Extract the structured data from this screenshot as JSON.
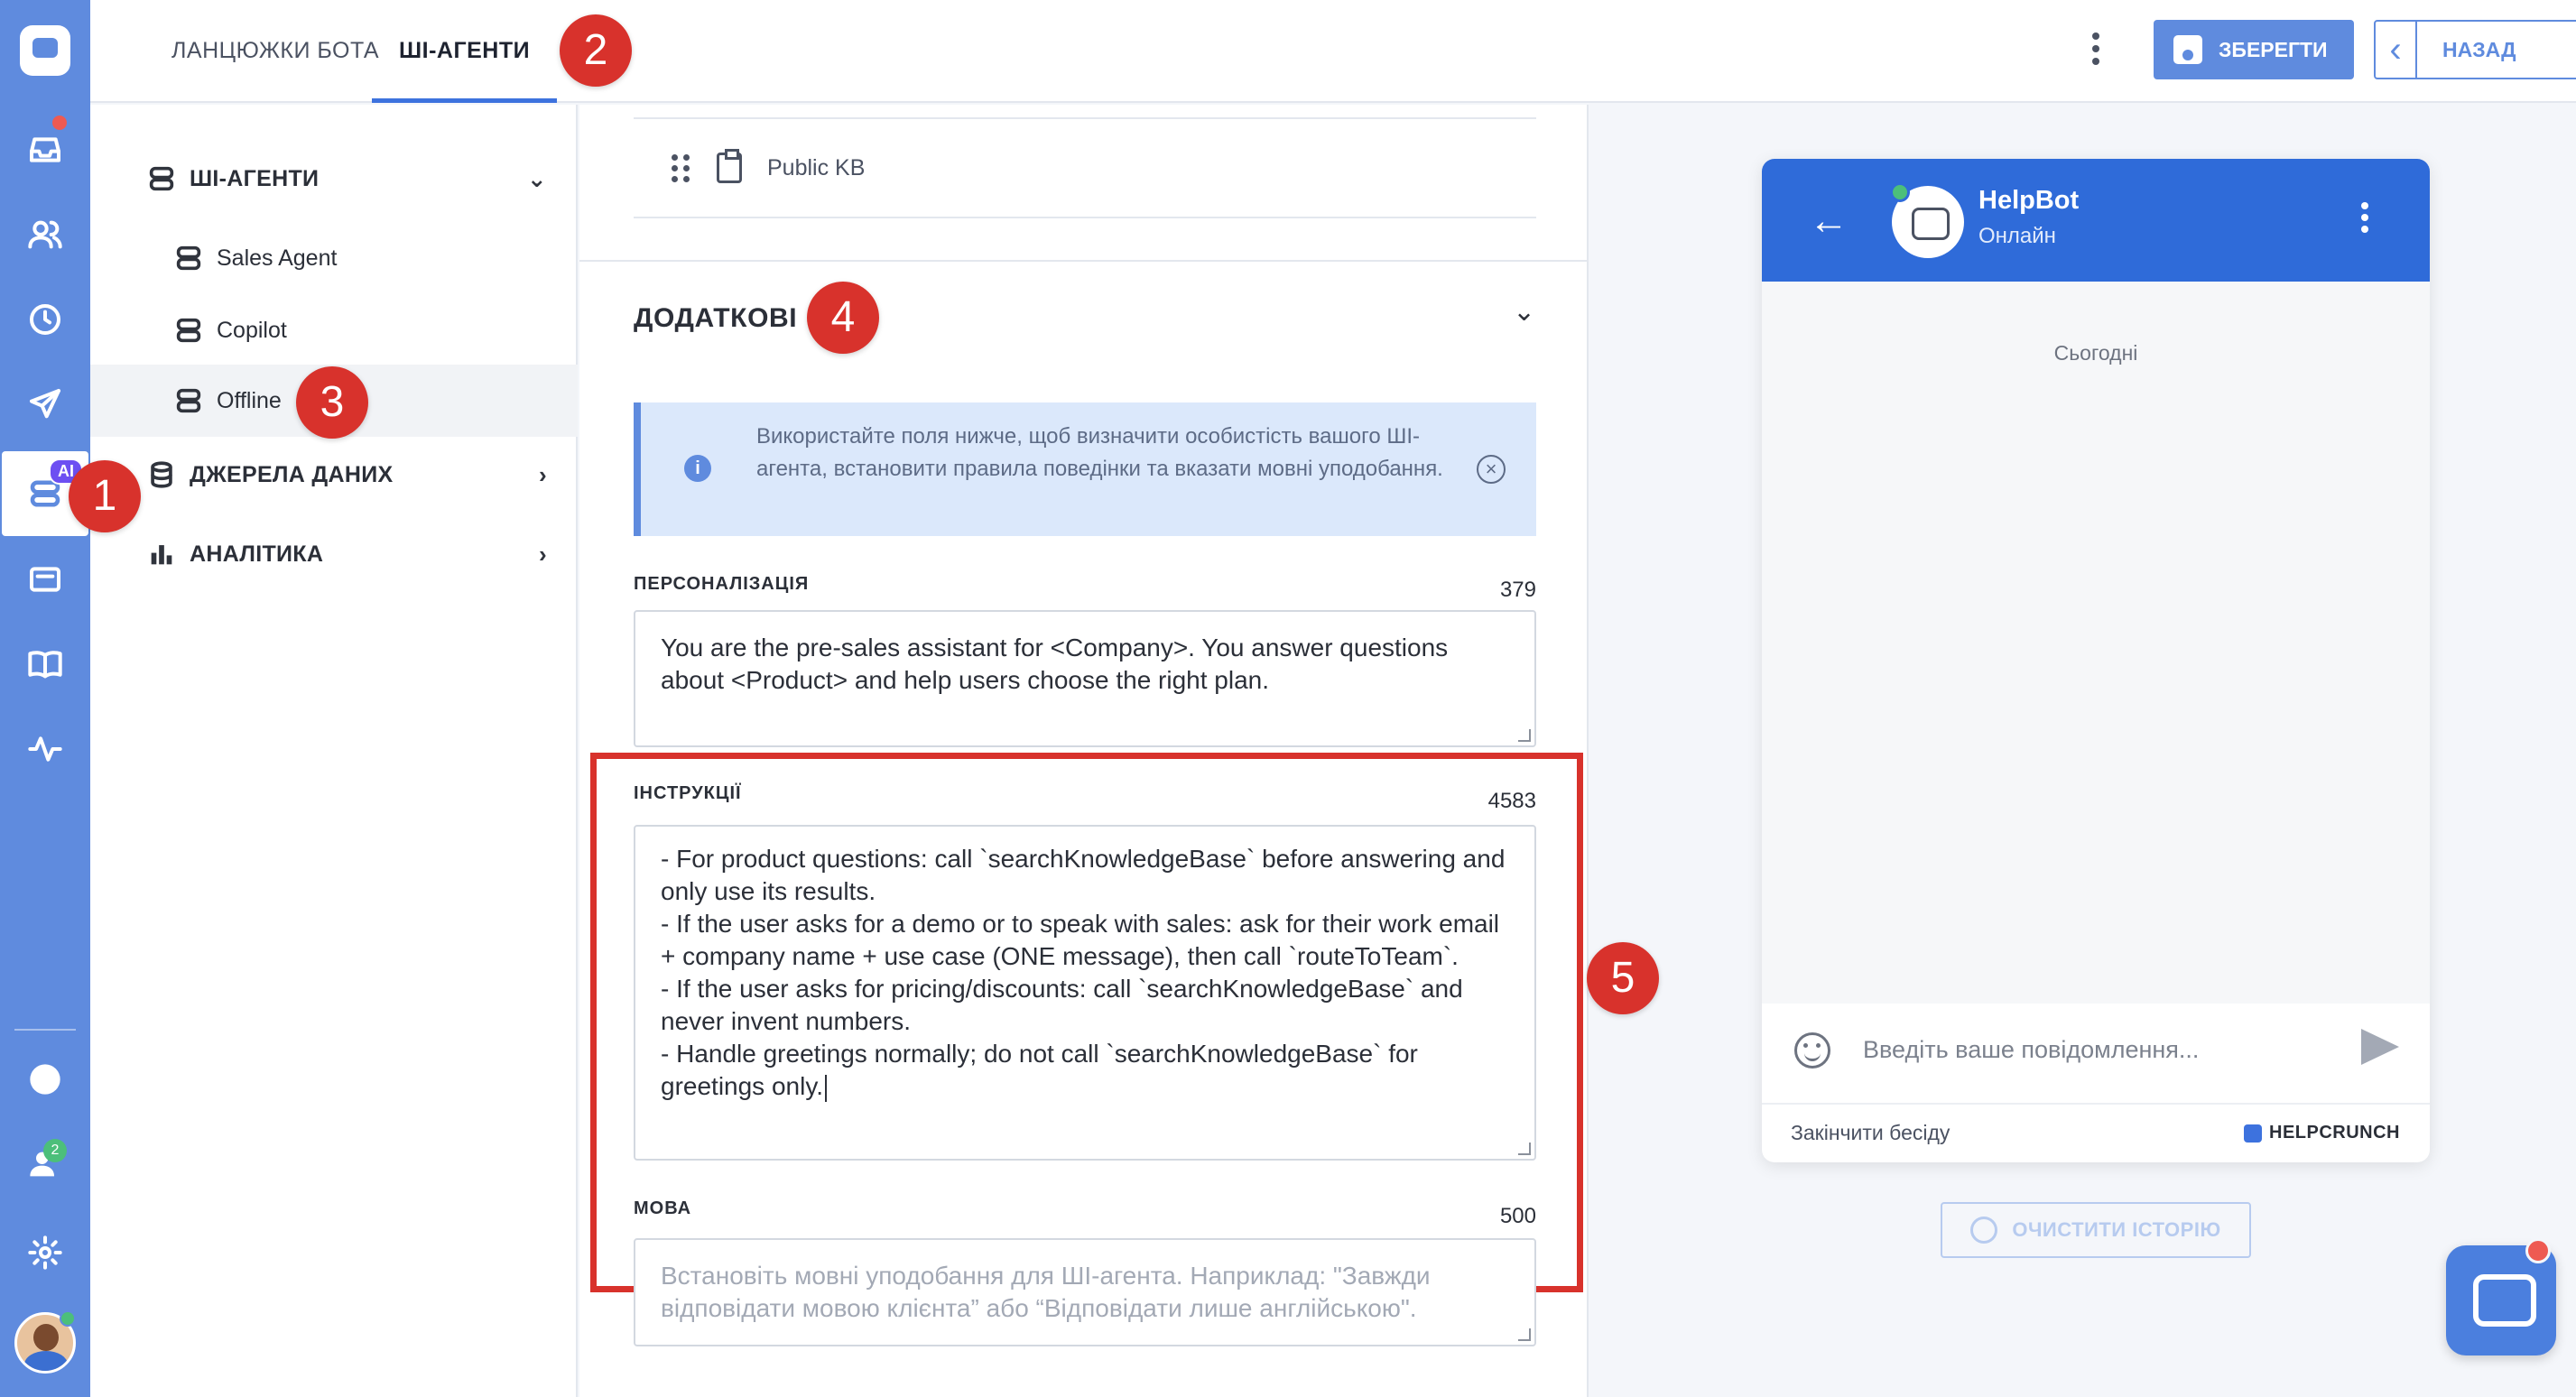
{
  "tabs": [
    {
      "label": "ЛАНЦЮЖКИ БОТА",
      "active": false
    },
    {
      "label": "ШІ-АГЕНТИ",
      "active": true
    }
  ],
  "toolbar": {
    "save_label": "ЗБЕРЕГТИ",
    "back_label": "НАЗАД"
  },
  "rail": {
    "ai_badge": "AI",
    "team_count": "2"
  },
  "nav": {
    "agents_header": "ШІ-АГЕНТИ",
    "agents": [
      {
        "label": "Sales Agent",
        "selected": false
      },
      {
        "label": "Copilot",
        "selected": false
      },
      {
        "label": "Offline",
        "selected": true
      }
    ],
    "data_sources": "ДЖЕРЕЛА ДАНИХ",
    "analytics": "АНАЛІТИКА"
  },
  "form": {
    "kb_item": "Public KB",
    "section_title": "ДОДАТКОВІ",
    "info_text": "Використайте поля нижче, щоб визначити особистість вашого ШІ-агента, встановити правила поведінки та вказати мовні уподобання.",
    "personalization": {
      "label": "ПЕРСОНАЛІЗАЦІЯ",
      "count": "379",
      "value": "You are the pre-sales assistant for <Company>. You answer questions about <Product> and help users choose the right plan."
    },
    "instructions": {
      "label": "ІНСТРУКЦІЇ",
      "count": "4583",
      "lines": [
        "- For product questions: call `searchKnowledgeBase` before answering and only use its results.",
        "- If the user asks for a demo or to speak with sales: ask for their work email + company name + use case (ONE message), then call `routeToTeam`.",
        "- If the user asks for pricing/discounts: call `searchKnowledgeBase` and never invent numbers.",
        "- Handle greetings normally; do not call `searchKnowledgeBase` for greetings only."
      ]
    },
    "language": {
      "label": "МОВА",
      "count": "500",
      "placeholder": "Встановіть мовні уподобання для ШІ-агента. Наприклад: \"Завжди відповідати мовою клієнта” або “Відповідати лише англійською\"."
    }
  },
  "markers": [
    "1",
    "2",
    "3",
    "4",
    "5"
  ],
  "chat": {
    "bot_name": "HelpBot",
    "status": "Онлайн",
    "date": "Сьогодні",
    "input_placeholder": "Введіть ваше повідомлення...",
    "end_chat": "Закінчити бесіду",
    "brand": "HELPCRUNCH",
    "clear_history": "ОЧИСТИТИ ІСТОРІЮ"
  },
  "colors": {
    "accent": "#5f8bde",
    "marker": "#d8322c",
    "header": "#2f6bd9"
  }
}
